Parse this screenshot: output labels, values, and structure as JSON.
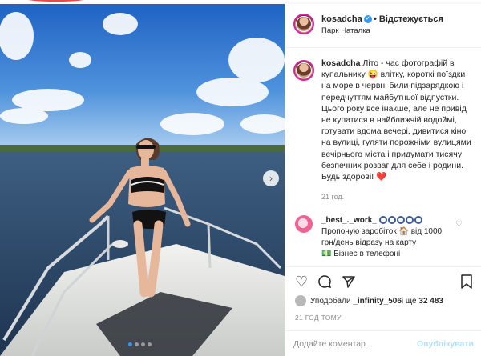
{
  "post": {
    "username": "kosadcha",
    "follow_label": "Відстежується",
    "location": "Парк Наталка",
    "caption_user": "kosadcha",
    "caption": "Літо - час фотографій в купальнику 😜 влітку, короткі поїздки на море в червні били підзарядкою і передчуттям майбутньої відпустки. Цього року все інакше, але не привід не купатися в найближчій водоймі, готувати вдома вечері, дивитися кіно на вулиці, гуляти порожніми вулицями вечірнього міста і придумати тисячу безпечних розваг для себе і родини. Будь здорові! ❤️",
    "caption_time": "21 год.",
    "comment_user": "_best_._work_",
    "comment_text": "Пропоную заробіток 🏠 від 1000 грн/день відразу на карту",
    "comment_more": "💵 Бізнес в телефоні",
    "likes_prefix": "Уподобали ",
    "likes_user": "_infinity_506",
    "likes_mid": " і ще ",
    "likes_count": "32 483",
    "time_ago": "21 ГОД ТОМУ",
    "comment_placeholder": "Додайте коментар...",
    "publish_label": "Опублікувати"
  },
  "carousel": {
    "slides": 4,
    "active": 1
  },
  "icons": {
    "verified": "verified-badge-icon",
    "like": "heart-icon",
    "comment": "comment-icon",
    "share": "paper-plane-icon",
    "save": "bookmark-icon",
    "next": "chevron-right-icon"
  },
  "colors": {
    "accent": "#3897f0",
    "publish_disabled": "#b2dffc",
    "text": "#262626",
    "muted": "#8e8e8e"
  }
}
